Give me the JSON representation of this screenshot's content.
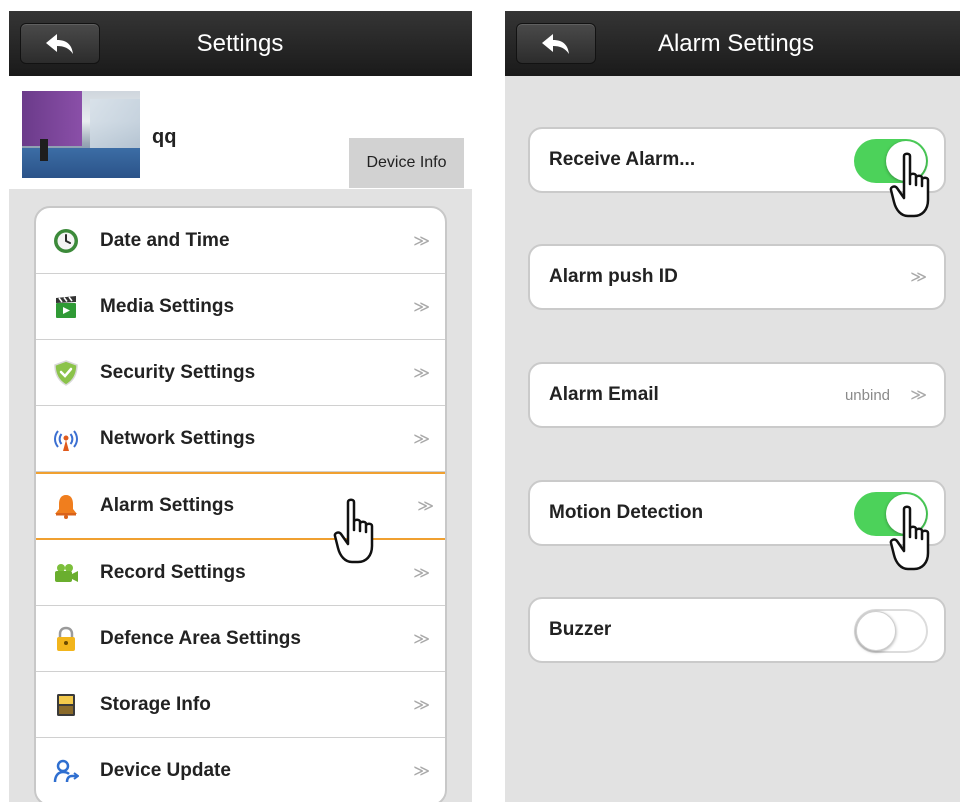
{
  "left": {
    "title": "Settings",
    "device": {
      "name": "qq",
      "info_button": "Device Info"
    },
    "menu": [
      {
        "label": "Date and Time",
        "icon": "clock-icon",
        "arrow": "≫"
      },
      {
        "label": "Media Settings",
        "icon": "clapperboard-icon",
        "arrow": "≫"
      },
      {
        "label": "Security Settings",
        "icon": "shield-icon",
        "arrow": "≫"
      },
      {
        "label": "Network Settings",
        "icon": "antenna-icon",
        "arrow": "≫"
      },
      {
        "label": "Alarm Settings",
        "icon": "bell-icon",
        "arrow": "≫",
        "selected": true
      },
      {
        "label": "Record Settings",
        "icon": "camcorder-icon",
        "arrow": "≫"
      },
      {
        "label": "Defence Area Settings",
        "icon": "lock-icon",
        "arrow": "≫"
      },
      {
        "label": "Storage Info",
        "icon": "storage-icon",
        "arrow": "≫"
      },
      {
        "label": "Device Update",
        "icon": "user-update-icon",
        "arrow": "≫"
      }
    ]
  },
  "right": {
    "title": "Alarm Settings",
    "rows": [
      {
        "label": "Receive Alarm...",
        "type": "toggle",
        "on": true
      },
      {
        "label": "Alarm push ID",
        "type": "link",
        "arrow": "≫"
      },
      {
        "label": "Alarm Email",
        "type": "link",
        "value": "unbind",
        "arrow": "≫"
      },
      {
        "label": "Motion Detection",
        "type": "toggle",
        "on": true
      },
      {
        "label": "Buzzer",
        "type": "toggle",
        "on": false
      }
    ]
  },
  "colors": {
    "navbar": "#262626",
    "toggle_on": "#4cd25a",
    "selected_border": "#f0a030",
    "list_background": "#e2e2e2"
  }
}
